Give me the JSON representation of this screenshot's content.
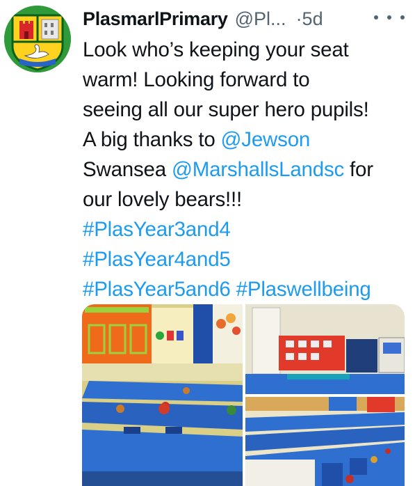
{
  "tweet": {
    "display_name": "PlasmarlPrimary",
    "handle": "@Pl...",
    "time": "·5d",
    "more_icon": "more-horizontal-icon",
    "line1": "Look who’s keeping your seat",
    "line2": "warm! Looking forward to",
    "line3": "seeing all our super hero pupils!",
    "line4_text": "A big thanks to ",
    "mention_jewson": "@Jewson",
    "line5_text": "Swansea ",
    "mention_marshalls": "@MarshallsLandsc",
    "line5_after": " for",
    "line6": "our lovely bears!!!",
    "hashtag1": "#PlasYear3and4",
    "hashtag2": "#PlasYear4and5",
    "hashtag3": "#PlasYear5and6",
    "hashtag4": "#Plaswellbeing"
  },
  "avatar": {
    "icon": "school-crest-icon"
  },
  "media": {
    "photos": [
      "classroom-photo-1",
      "classroom-photo-2",
      "classroom-photo-3"
    ]
  },
  "colors": {
    "link": "#1d9bf0",
    "secondary_text": "#536471",
    "avatar_green": "#2f9a3a",
    "desk_blue": "#2f6fd0"
  }
}
